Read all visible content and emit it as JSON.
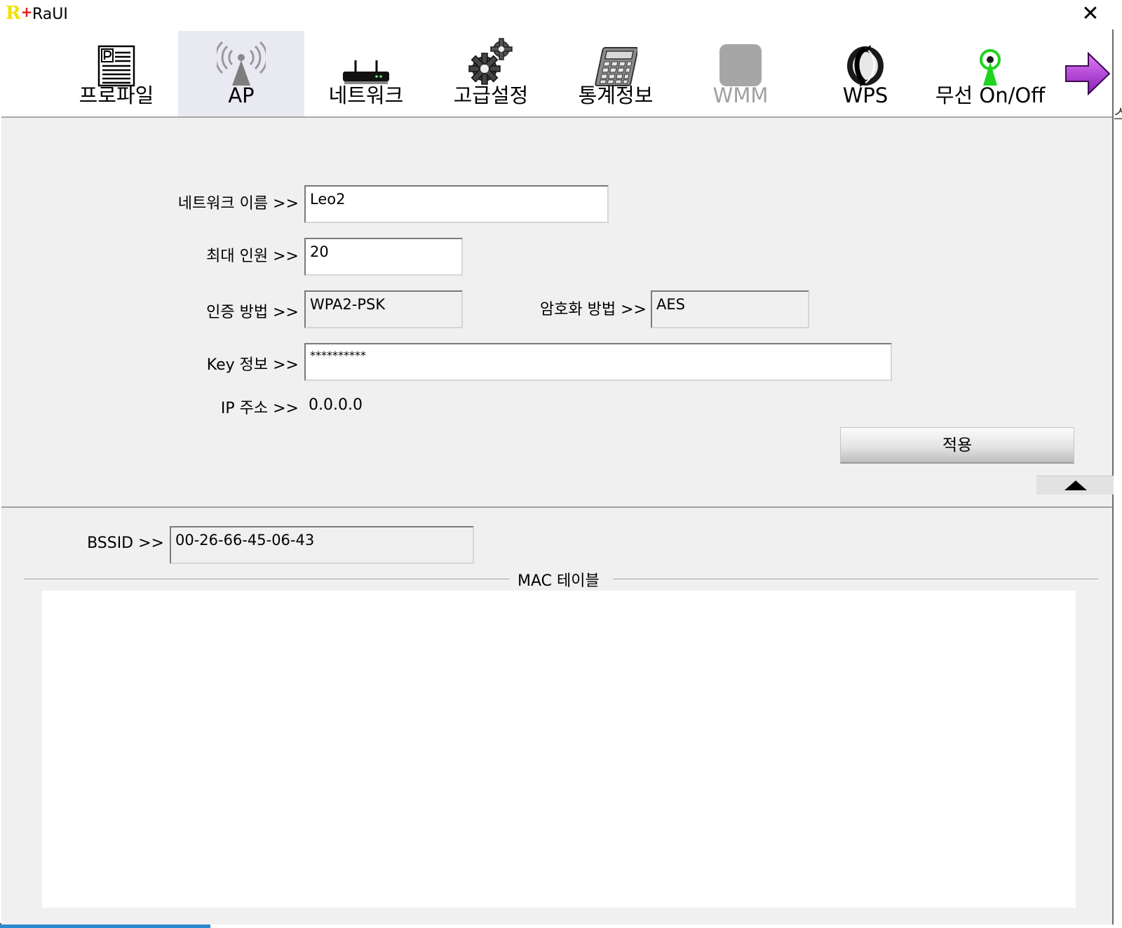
{
  "window": {
    "title": "RaUI",
    "logo": {
      "letter": "R",
      "plus": "+"
    },
    "close_glyph": "✕"
  },
  "toolbar": {
    "items": [
      {
        "id": "profile",
        "label": "프로파일",
        "icon": "profile-document-icon",
        "active": false,
        "enabled": true
      },
      {
        "id": "ap",
        "label": "AP",
        "icon": "ap-antenna-icon",
        "active": true,
        "enabled": true
      },
      {
        "id": "network",
        "label": "네트워크",
        "icon": "router-icon",
        "active": false,
        "enabled": true
      },
      {
        "id": "advanced",
        "label": "고급설정",
        "icon": "gears-icon",
        "active": false,
        "enabled": true
      },
      {
        "id": "statistics",
        "label": "통계정보",
        "icon": "calculator-icon",
        "active": false,
        "enabled": true
      },
      {
        "id": "wmm",
        "label": "WMM",
        "icon": "wmm-icon",
        "active": false,
        "enabled": false
      },
      {
        "id": "wps",
        "label": "WPS",
        "icon": "wps-icon",
        "active": false,
        "enabled": true
      },
      {
        "id": "radio",
        "label": "무선 On/Off",
        "icon": "radio-toggle-icon",
        "active": false,
        "enabled": true
      }
    ],
    "next_icon": "arrow-right-icon",
    "edge_glyph": "스"
  },
  "ap_settings": {
    "network_name": {
      "label": "네트워크 이름 >>",
      "value": "Leo2"
    },
    "max_clients": {
      "label": "최대 인원 >>",
      "value": "20"
    },
    "auth_method": {
      "label": "인증 방법 >>",
      "value": "WPA2-PSK"
    },
    "encryption": {
      "label": "암호화 방법 >>",
      "value": "AES"
    },
    "key_info": {
      "label": "Key 정보 >>",
      "value": "**********"
    },
    "ip_address": {
      "label": "IP 주소 >>",
      "value": "0.0.0.0"
    },
    "apply_label": "적용"
  },
  "mac_section": {
    "bssid": {
      "label": "BSSID >>",
      "value": "00-26-66-45-06-43"
    },
    "table_title": "MAC 테이블",
    "rows": []
  },
  "colors": {
    "panel_bg": "#f0f0f0",
    "active_tab_bg": "#e9e9f2",
    "logo_yellow": "#f2e000",
    "logo_red": "#e01818",
    "radio_green": "#1fd31f",
    "arrow_purple": "#b030d8"
  }
}
